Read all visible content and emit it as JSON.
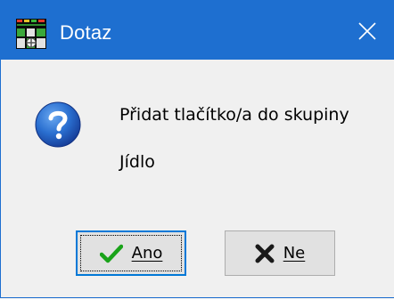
{
  "window": {
    "title": "Dotaz",
    "app_icon": "app-logo-icon",
    "close_icon": "close-icon"
  },
  "message": {
    "line1": "Přidat tlačítko/a do skupiny",
    "line2": "Jídlo",
    "icon": "question-icon"
  },
  "buttons": {
    "yes_label": "Ano",
    "yes_icon": "checkmark-icon",
    "no_label": "Ne",
    "no_icon": "cross-icon"
  },
  "colors": {
    "titlebar": "#1e6fd0",
    "background": "#f0f0f0",
    "check_green": "#1aa31a",
    "cross_dark": "#1a1a1a"
  }
}
